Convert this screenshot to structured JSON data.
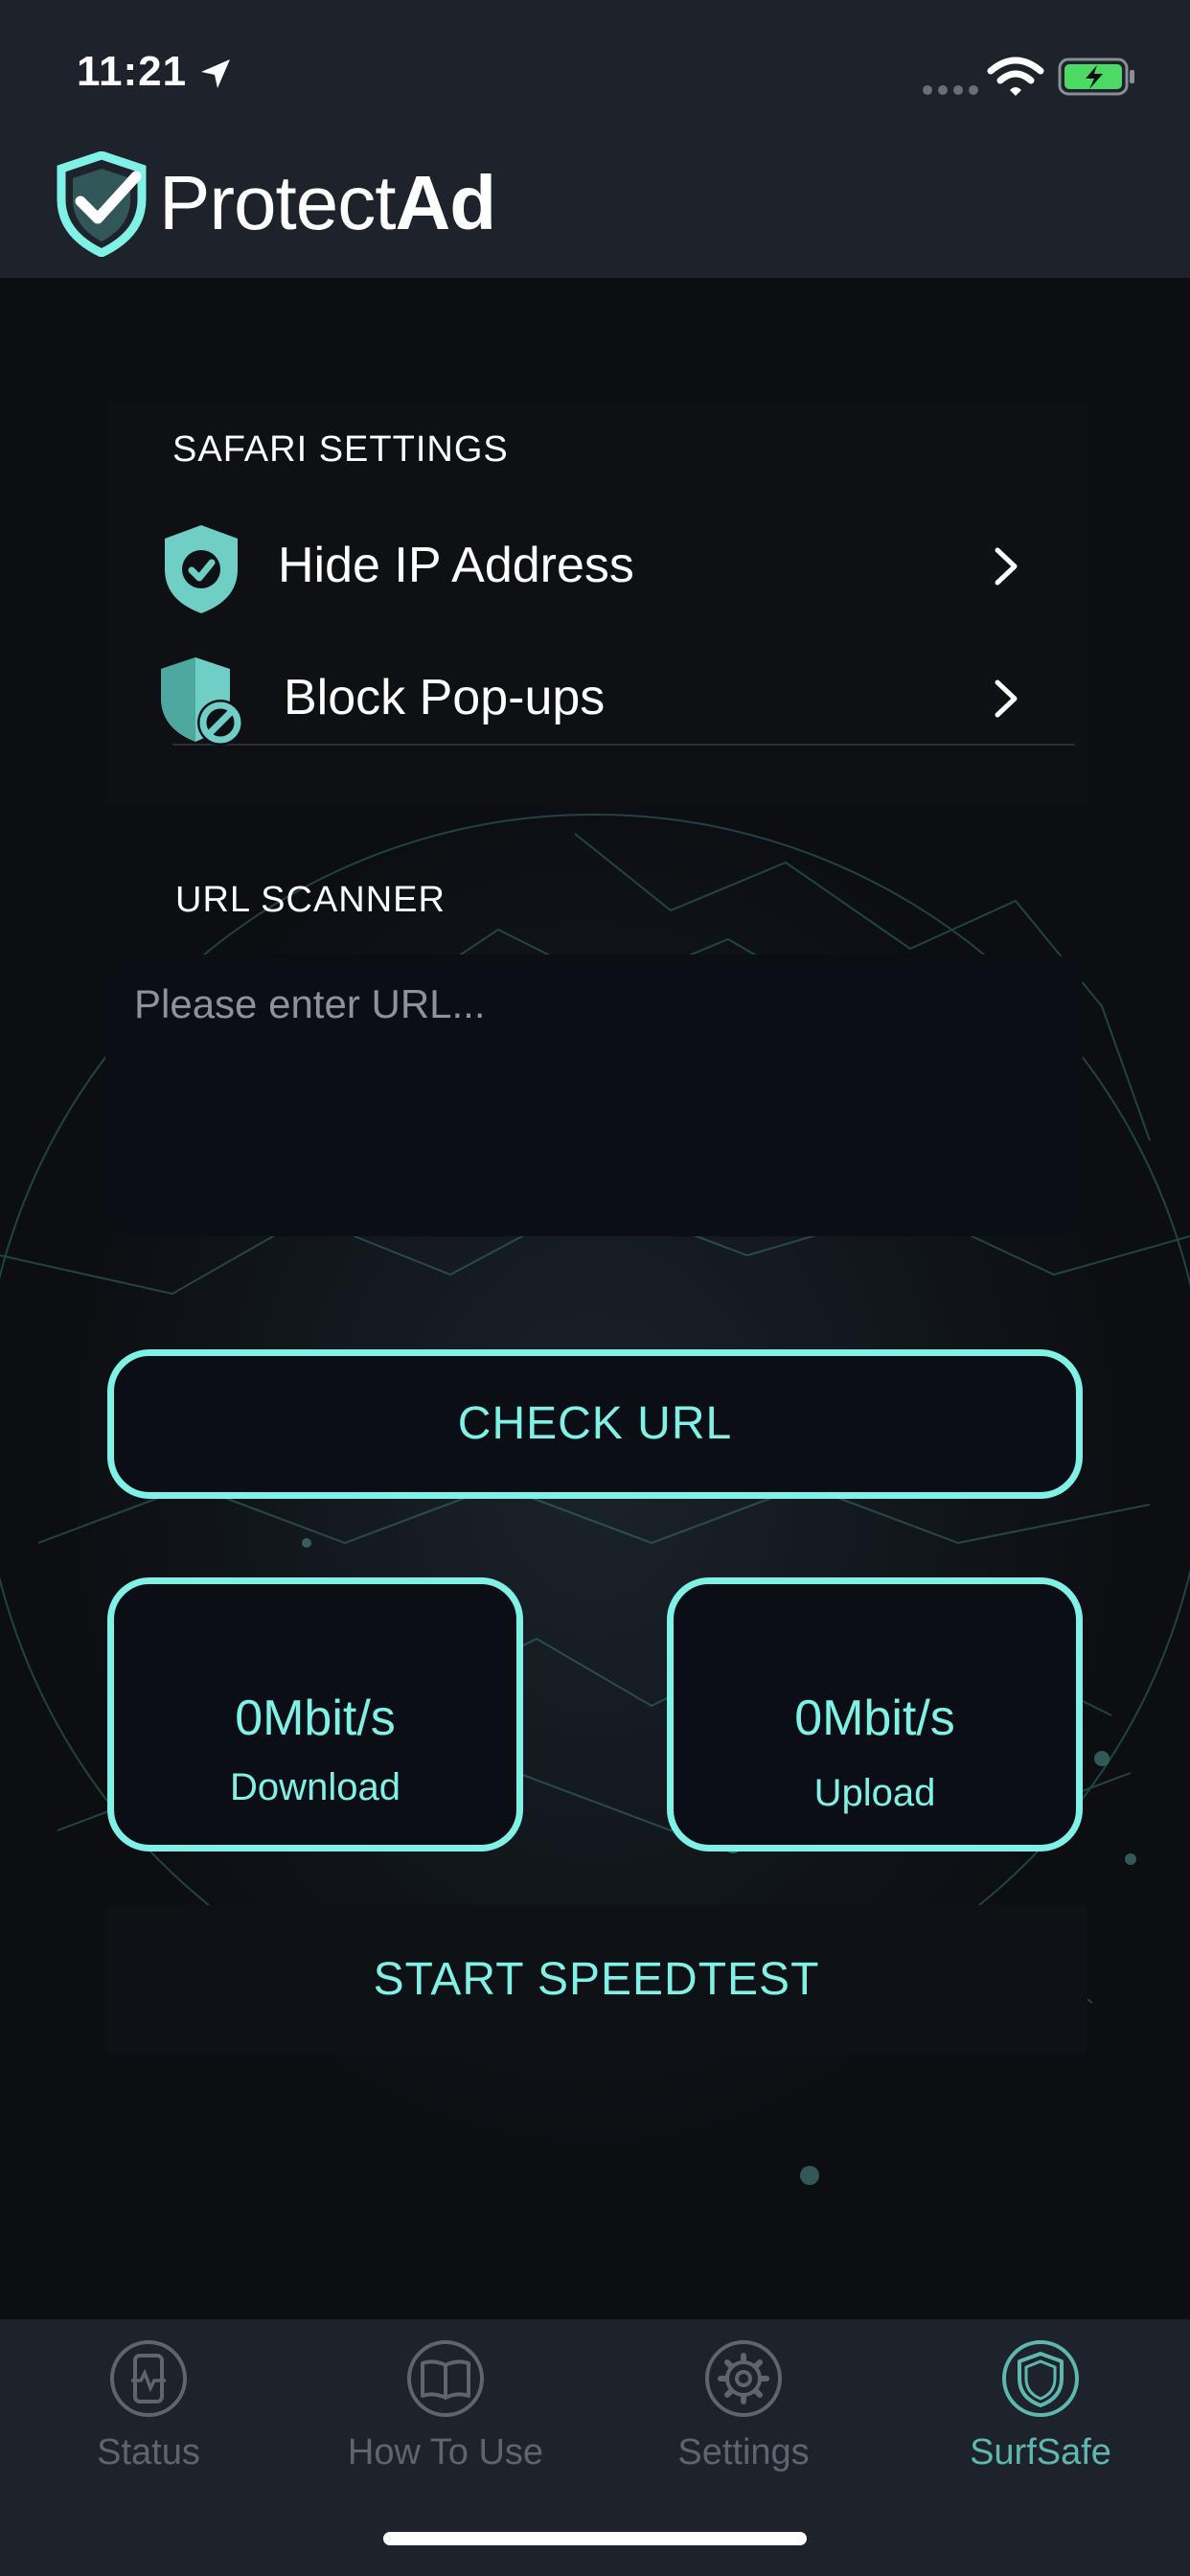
{
  "status_bar": {
    "time": "11:21",
    "icons": [
      "location-arrow-icon",
      "signal-dots-icon",
      "wifi-icon",
      "battery-charging-icon"
    ]
  },
  "header": {
    "brand_light": "Protect",
    "brand_bold": "Ad",
    "logo_icon": "shield-check-logo"
  },
  "safari_settings": {
    "title": "SAFARI SETTINGS",
    "items": [
      {
        "label": "Hide IP Address",
        "icon": "shield-check-icon"
      },
      {
        "label": "Block Pop-ups",
        "icon": "shield-block-icon"
      }
    ]
  },
  "url_scanner": {
    "title": "URL SCANNER",
    "placeholder": "Please enter URL...",
    "value": "",
    "check_button": "CHECK URL"
  },
  "speedtest": {
    "download_value": "0Mbit/s",
    "download_label": "Download",
    "upload_value": "0Mbit/s",
    "upload_label": "Upload",
    "start_button": "START SPEEDTEST"
  },
  "tabbar": {
    "tabs": [
      {
        "label": "Status",
        "icon": "phone-pulse-icon",
        "active": false
      },
      {
        "label": "How To Use",
        "icon": "book-icon",
        "active": false
      },
      {
        "label": "Settings",
        "icon": "gear-icon",
        "active": false
      },
      {
        "label": "SurfSafe",
        "icon": "shield-icon",
        "active": true
      }
    ]
  },
  "colors": {
    "accent": "#7ff1e6",
    "bar_background": "#1d222b",
    "background": "#0b0d10",
    "tab_inactive": "#5f656d",
    "tab_active": "#5fb8b0"
  }
}
